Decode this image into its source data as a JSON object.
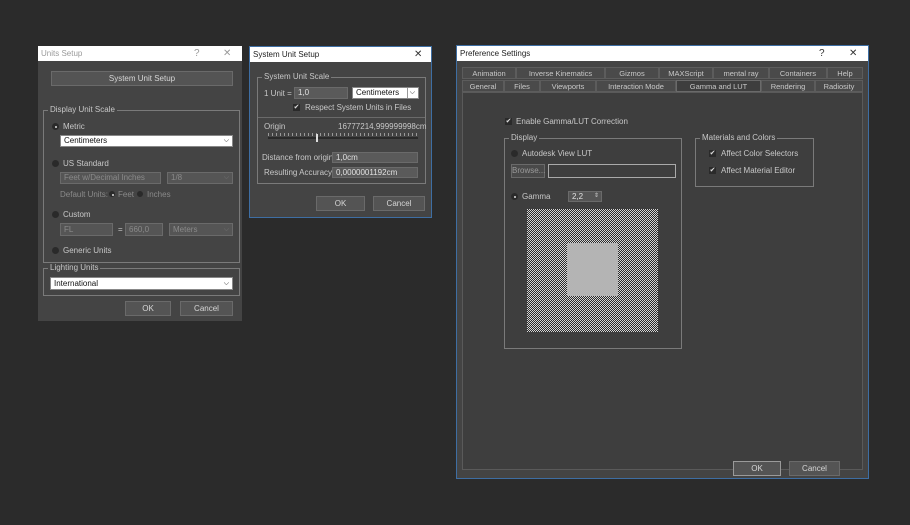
{
  "units_setup": {
    "title": "Units Setup",
    "help_glyph": "?",
    "close_glyph": "✕",
    "system_unit_setup_label": "System Unit Setup",
    "display_unit_scale_title": "Display Unit Scale",
    "metric_label": "Metric",
    "metric_value": "Centimeters",
    "us_standard_label": "US Standard",
    "us_value": "Feet w/Decimal Inches",
    "us_fraction": "1/8",
    "default_units_label": "Default Units:",
    "feet_label": "Feet",
    "inches_label": "Inches",
    "custom_label": "Custom",
    "custom_name": "FL",
    "equals": "=",
    "custom_value": "660,0",
    "custom_unit": "Meters",
    "generic_units_label": "Generic Units",
    "lighting_units_title": "Lighting Units",
    "lighting_value": "International",
    "ok_label": "OK",
    "cancel_label": "Cancel"
  },
  "system_unit_setup": {
    "title": "System Unit Setup",
    "close_glyph": "✕",
    "scale_group_title": "System Unit Scale",
    "unit_label": "1 Unit =",
    "unit_value": "1,0",
    "unit_type": "Centimeters",
    "respect_label": "Respect System Units in Files",
    "origin_label": "Origin",
    "origin_value": "16777214,999999998cm",
    "distance_label": "Distance from origin:",
    "distance_value": "1,0cm",
    "accuracy_label": "Resulting Accuracy:",
    "accuracy_value": "0,0000001192cm",
    "ok_label": "OK",
    "cancel_label": "Cancel"
  },
  "preference_settings": {
    "title": "Preference Settings",
    "help_glyph": "?",
    "close_glyph": "✕",
    "tabs_row1": [
      "Animation",
      "Inverse Kinematics",
      "Gizmos",
      "MAXScript",
      "mental ray",
      "Containers",
      "Help"
    ],
    "tabs_row2": [
      "General",
      "Files",
      "Viewports",
      "Interaction Mode",
      "Gamma and LUT",
      "Rendering",
      "Radiosity"
    ],
    "active_tab": "Gamma and LUT",
    "enable_label": "Enable Gamma/LUT Correction",
    "display_group_title": "Display",
    "autodesk_lut_label": "Autodesk View LUT",
    "browse_label": "Browse...",
    "gamma_label": "Gamma",
    "gamma_value": "2,2",
    "materials_group_title": "Materials and Colors",
    "affect_color_label": "Affect Color Selectors",
    "affect_material_label": "Affect Material Editor",
    "ok_label": "OK",
    "cancel_label": "Cancel"
  }
}
